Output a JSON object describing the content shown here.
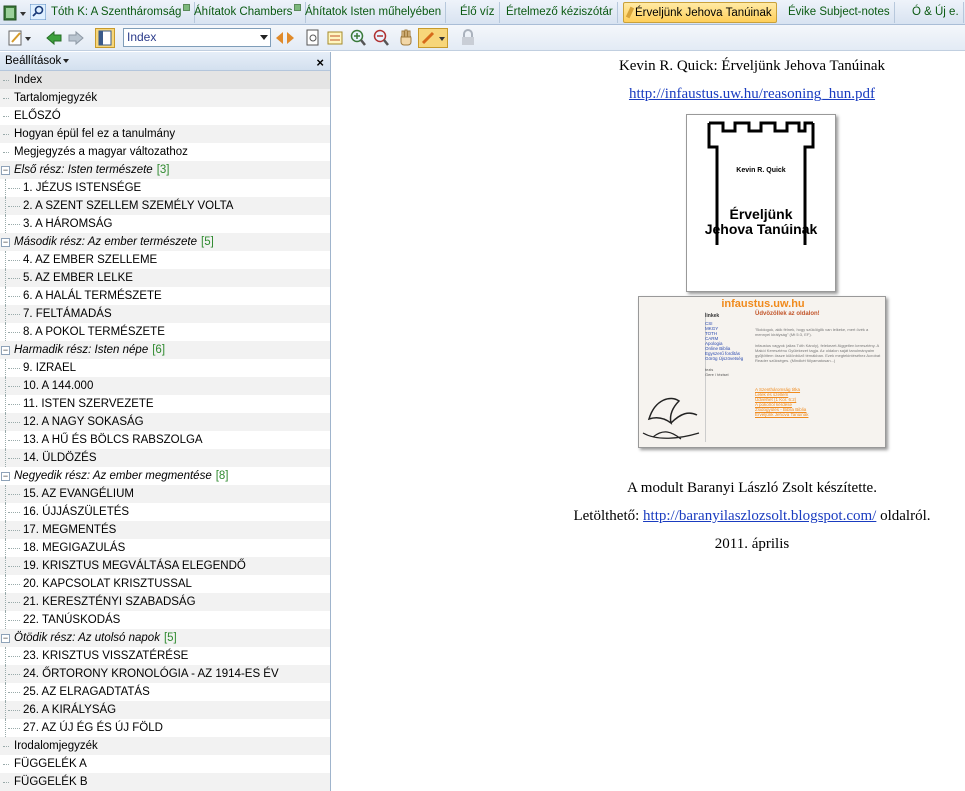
{
  "tabs": [
    {
      "label": "Tóth K: A Szentháromság",
      "pinned": true,
      "active": false
    },
    {
      "label": "Áhítatok Chambers",
      "pinned": true,
      "active": false
    },
    {
      "label": "Áhítatok Isten műhelyében",
      "pinned": false,
      "active": false
    },
    {
      "label": "Élő víz",
      "pinned": false,
      "active": false
    },
    {
      "label": "Értelmező kéziszótár",
      "pinned": false,
      "active": false
    },
    {
      "label": "Érveljünk Jehova Tanúinak",
      "pinned": false,
      "active": true
    },
    {
      "label": "Évike Subject-notes",
      "pinned": false,
      "active": false
    },
    {
      "label": "Ó & Új e.",
      "pinned": false,
      "active": false
    }
  ],
  "toolbar": {
    "index_select_value": "Index"
  },
  "sidebar": {
    "header": "Beállítások",
    "close": "×",
    "items": [
      {
        "label": "Index",
        "type": "item",
        "selected": true
      },
      {
        "label": "Tartalomjegyzék",
        "type": "item"
      },
      {
        "label": "ELŐSZÓ",
        "type": "item"
      },
      {
        "label": "Hogyan épül fel ez a tanulmány",
        "type": "item"
      },
      {
        "label": "Megjegyzés a magyar változathoz",
        "type": "item"
      },
      {
        "label": "Első rész: Isten természete",
        "type": "group",
        "count": "[3]"
      },
      {
        "label": "1. JÉZUS ISTENSÉGE",
        "type": "child"
      },
      {
        "label": "2. A SZENT SZELLEM SZEMÉLY VOLTA",
        "type": "child"
      },
      {
        "label": "3. A HÁROMSÁG",
        "type": "child"
      },
      {
        "label": "Második rész: Az ember természete",
        "type": "group",
        "count": "[5]"
      },
      {
        "label": "4. AZ EMBER SZELLEME",
        "type": "child"
      },
      {
        "label": "5. AZ EMBER LELKE",
        "type": "child"
      },
      {
        "label": "6. A HALÁL TERMÉSZETE",
        "type": "child"
      },
      {
        "label": "7. FELTÁMADÁS",
        "type": "child"
      },
      {
        "label": "8. A POKOL TERMÉSZETE",
        "type": "child"
      },
      {
        "label": "Harmadik rész: Isten népe",
        "type": "group",
        "count": "[6]"
      },
      {
        "label": "9. IZRAEL",
        "type": "child"
      },
      {
        "label": "10. A 144.000",
        "type": "child"
      },
      {
        "label": "11. ISTEN SZERVEZETE",
        "type": "child"
      },
      {
        "label": "12. A NAGY SOKASÁG",
        "type": "child"
      },
      {
        "label": "13. A HŰ ÉS BÖLCS RABSZOLGA",
        "type": "child"
      },
      {
        "label": "14. ÜLDÖZÉS",
        "type": "child"
      },
      {
        "label": "Negyedik rész: Az ember megmentése",
        "type": "group",
        "count": "[8]"
      },
      {
        "label": "15. AZ EVANGÉLIUM",
        "type": "child"
      },
      {
        "label": "16. ÚJJÁSZÜLETÉS",
        "type": "child"
      },
      {
        "label": "17. MEGMENTÉS",
        "type": "child"
      },
      {
        "label": "18. MEGIGAZULÁS",
        "type": "child"
      },
      {
        "label": "19. KRISZTUS MEGVÁLTÁSA ELEGENDŐ",
        "type": "child"
      },
      {
        "label": "20. KAPCSOLAT KRISZTUSSAL",
        "type": "child"
      },
      {
        "label": "21. KERESZTÉNYI SZABADSÁG",
        "type": "child"
      },
      {
        "label": "22. TANÚSKODÁS",
        "type": "child"
      },
      {
        "label": "Ötödik rész: Az utolsó napok",
        "type": "group",
        "count": "[5]"
      },
      {
        "label": "23. KRISZTUS VISSZATÉRÉSE",
        "type": "child"
      },
      {
        "label": "24. ŐRTORONY KRONOLÓGIA - AZ 1914-ES ÉV",
        "type": "child"
      },
      {
        "label": "25. AZ ELRAGADTATÁS",
        "type": "child"
      },
      {
        "label": "26. A KIRÁLYSÁG",
        "type": "child"
      },
      {
        "label": "27. AZ ÚJ ÉG ÉS ÚJ FÖLD",
        "type": "child"
      },
      {
        "label": "Irodalomjegyzék",
        "type": "item"
      },
      {
        "label": "FÜGGELÉK A",
        "type": "item"
      },
      {
        "label": "FÜGGELÉK B",
        "type": "item"
      }
    ]
  },
  "content": {
    "title": "Kevin R. Quick: Érveljünk Jehova Tanúinak",
    "pdf_link": "http://infaustus.uw.hu/reasoning_hun.pdf",
    "cover": {
      "author": "Kevin R. Quick",
      "title_line1": "Érveljünk",
      "title_line2": "Jehova Tanúinak"
    },
    "site": {
      "header": "infaustus.uw.hu",
      "welcome": "Üdvözöllek az oldalon!",
      "nav_title": "linkek",
      "nav_items": [
        "CSI",
        "MKGY",
        "TOTH",
        "CARM",
        "Apologia",
        "Online Biblia",
        "Egyszerű fordítás",
        "Görög Újszövetség"
      ],
      "side_lines": [
        "tezis",
        "Gere / tézisei"
      ],
      "quote": "\"Boldogok, akik félnek, hogy szükölgők van lelkeke, mert övék a mennyei királyság\" (Mt 5:3, EF).",
      "body_text": "infaustus vagyok (alias Tóth Károly), felekezet-független keresztény. A Makói Kereszténu Gyülekezet tagja. Az oldalon saját tanulmányaim gyűjtöttem össze különböző témákban. Ezek megtekintéséhez Acrobat Reader szükséges. (Mindkét fölyamatosan...)",
      "links": [
        "A Szentháromság titka",
        "Lelek és szellem",
        "Üdvelhet (1 Kor. 6:2)",
        "A pokolról kérdése",
        "Zsidógyűlés - Biblia Biblia",
        "Érveljünk Jehova Tanúinak"
      ]
    },
    "credit": "A modult Baranyi László Zsolt készítette.",
    "download_prefix": "Letölthető:",
    "download_link": "http://baranyilaszlozsolt.blogspot.com/",
    "download_suffix": "oldalról.",
    "date": "2011. április"
  },
  "colors": {
    "tab_text": "#0b5a12",
    "tab_active": "#ffcf5a",
    "link": "#1a3cc0",
    "count": "#2f8a2f",
    "site_orange": "#f08a1c"
  },
  "icons": [
    "book-icon",
    "search-icon",
    "pin-icon",
    "pencil-icon",
    "edit-icon",
    "back-arrow-icon",
    "forward-arrow-icon",
    "panel-toggle-icon",
    "prev-next-icon",
    "page-icon",
    "highlight-icon",
    "zoom-in-icon",
    "zoom-out-icon",
    "hand-icon",
    "marker-icon",
    "lock-icon"
  ]
}
